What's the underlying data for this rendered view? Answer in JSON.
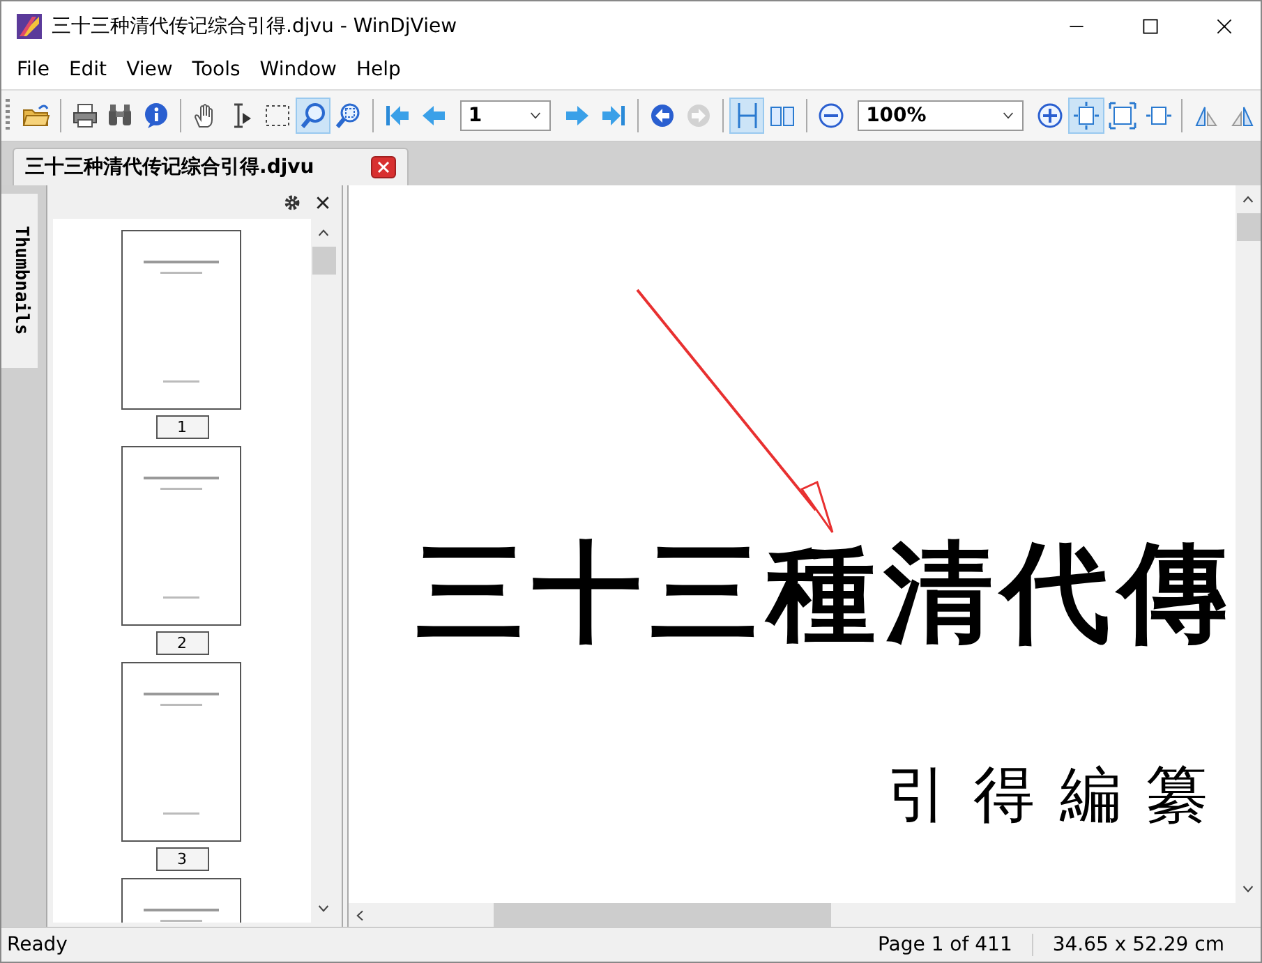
{
  "window": {
    "title": "三十三种清代传记综合引得.djvu - WinDjView"
  },
  "menu": [
    "File",
    "Edit",
    "View",
    "Tools",
    "Window",
    "Help"
  ],
  "toolbar": [
    [
      {
        "kind": "button",
        "selected": false,
        "disabled": false
      }
    ],
    [
      {
        "kind": "button",
        "selected": false,
        "disabled": false
      },
      {
        "kind": "button",
        "selected": false,
        "disabled": false
      },
      {
        "kind": "button",
        "selected": false,
        "disabled": false
      }
    ],
    [
      {
        "kind": "button",
        "selected": false,
        "disabled": false
      },
      {
        "kind": "button",
        "selected": false,
        "disabled": false
      },
      {
        "kind": "button",
        "selected": false,
        "disabled": false
      },
      {
        "kind": "button",
        "selected": true,
        "disabled": false
      },
      {
        "kind": "button",
        "selected": false,
        "disabled": false
      }
    ],
    [
      {
        "kind": "button",
        "selected": false,
        "disabled": false
      },
      {
        "kind": "button",
        "selected": false,
        "disabled": false
      },
      {
        "kind": "combo",
        "value": "1"
      },
      {
        "kind": "button",
        "selected": false,
        "disabled": false
      },
      {
        "kind": "button",
        "selected": false,
        "disabled": false
      }
    ],
    [
      {
        "kind": "button",
        "selected": false,
        "disabled": false
      },
      {
        "kind": "button",
        "selected": false,
        "disabled": true
      }
    ],
    [
      {
        "kind": "button",
        "selected": true,
        "disabled": false
      },
      {
        "kind": "button",
        "selected": false,
        "disabled": false
      }
    ],
    [
      {
        "kind": "button",
        "selected": false,
        "disabled": false
      },
      {
        "kind": "combo",
        "value": "100%"
      },
      {
        "kind": "button",
        "selected": false,
        "disabled": false
      },
      {
        "kind": "button",
        "selected": true,
        "disabled": false
      },
      {
        "kind": "button",
        "selected": false,
        "disabled": false
      },
      {
        "kind": "button",
        "selected": false,
        "disabled": false
      }
    ],
    [
      {
        "kind": "button",
        "selected": false,
        "disabled": false
      },
      {
        "kind": "button",
        "selected": false,
        "disabled": false
      }
    ]
  ],
  "tabs": [
    {
      "label": "三十三种清代传记综合引得.djvu",
      "selected": true
    }
  ],
  "sidebar": {
    "tab": "Thumbnails",
    "thumbnails": [
      {
        "kind": "page",
        "label": "1"
      },
      {
        "kind": "page",
        "label": "2"
      },
      {
        "kind": "page",
        "label": "3"
      },
      {
        "kind": "cut"
      }
    ]
  },
  "document": {
    "heading": "三十三種清代傳",
    "subheading": "引得編纂"
  },
  "status_bar": {
    "message": "Ready",
    "page": "Page 1 of 411",
    "size": "34.65 x 52.29 cm"
  }
}
